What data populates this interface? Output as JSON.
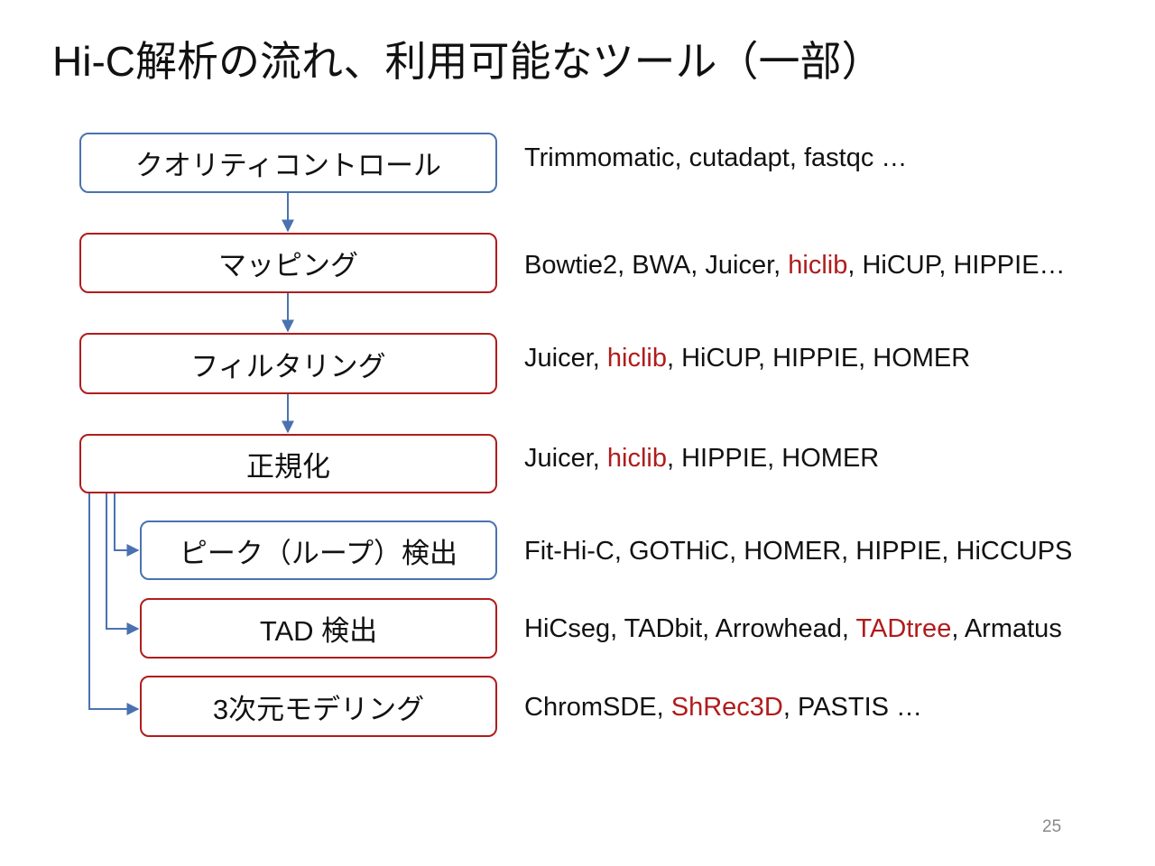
{
  "title": "Hi-C解析の流れ、利用可能なツール（一部）",
  "colors": {
    "qc_border": "#4a72b0",
    "step_border": "#b01c1c",
    "connector": "#4a72b0",
    "highlight_text": "#b01c1c"
  },
  "steps": [
    {
      "label": "クオリティコントロール",
      "border": "blue",
      "tools": [
        {
          "t": "Trimmomatic, cutadapt, fastqc …"
        }
      ]
    },
    {
      "label": "マッピング",
      "border": "red",
      "tools": [
        {
          "t": "Bowtie2, BWA, Juicer, "
        },
        {
          "t": "hiclib",
          "hl": true
        },
        {
          "t": ", HiCUP, HIPPIE…"
        }
      ]
    },
    {
      "label": "フィルタリング",
      "border": "red",
      "tools": [
        {
          "t": "Juicer, "
        },
        {
          "t": "hiclib",
          "hl": true
        },
        {
          "t": ", HiCUP, HIPPIE, HOMER"
        }
      ]
    },
    {
      "label": "正規化",
      "border": "red",
      "tools": [
        {
          "t": "Juicer, "
        },
        {
          "t": "hiclib",
          "hl": true
        },
        {
          "t": ", HIPPIE, HOMER"
        }
      ]
    },
    {
      "label": "ピーク（ループ）検出",
      "border": "blue",
      "tools": [
        {
          "t": "Fit-Hi-C, GOTHiC, HOMER, HIPPIE, HiCCUPS"
        }
      ]
    },
    {
      "label": "TAD 検出",
      "border": "red",
      "tools": [
        {
          "t": "HiCseg, TADbit, Arrowhead, "
        },
        {
          "t": "TADtree",
          "hl": true
        },
        {
          "t": ", Armatus"
        }
      ]
    },
    {
      "label": "3次元モデリング",
      "border": "red",
      "tools": [
        {
          "t": "ChromSDE, "
        },
        {
          "t": "ShRec3D",
          "hl": true
        },
        {
          "t": ", PASTIS …"
        }
      ]
    }
  ],
  "page_number": "25"
}
